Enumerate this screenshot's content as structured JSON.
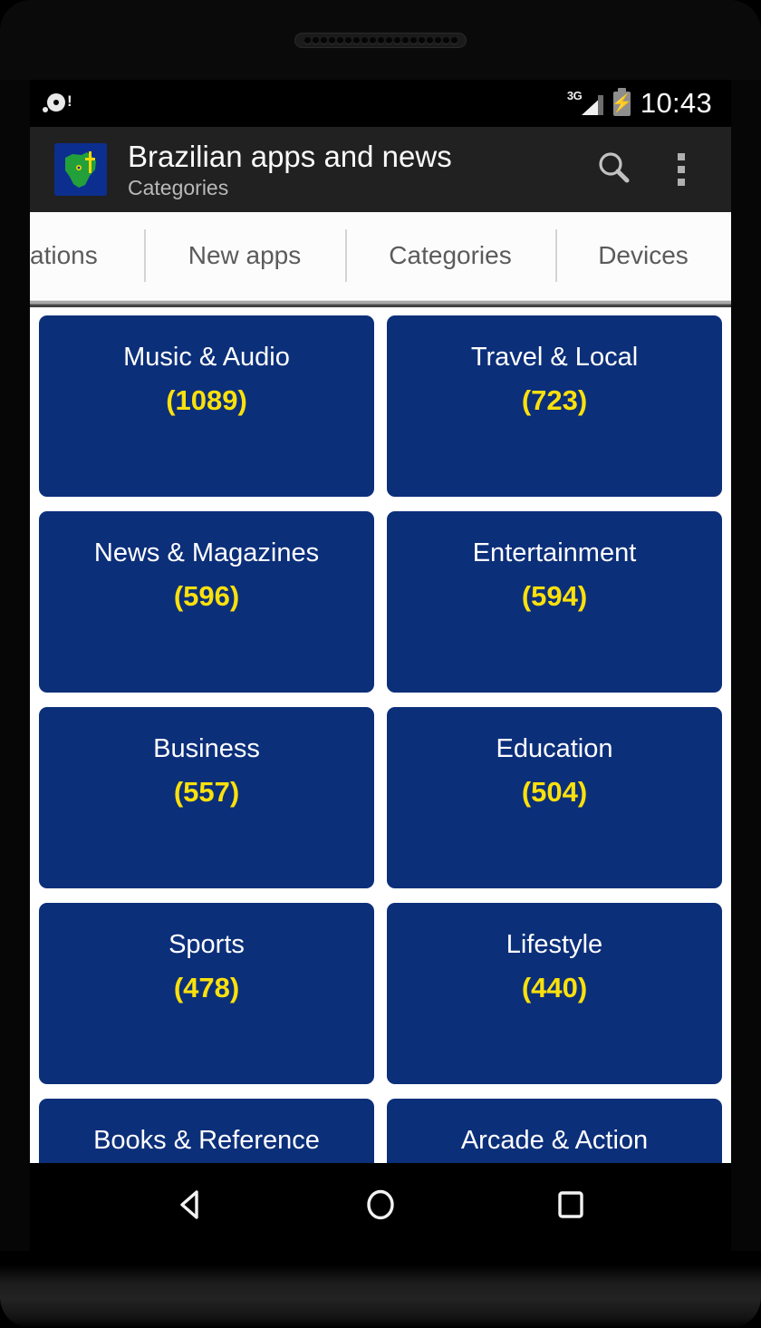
{
  "device": {
    "earpiece_holes": 19,
    "nav": [
      {
        "name": "back",
        "icon": "back-triangle-icon"
      },
      {
        "name": "home",
        "icon": "home-circle-icon"
      },
      {
        "name": "recents",
        "icon": "recents-square-icon"
      }
    ]
  },
  "status_bar": {
    "storage_icon": "sd-card-alert-icon",
    "network_label": "3G",
    "signal_icon": "signal-triangle-icon",
    "battery_icon": "battery-charging-icon",
    "time": "10:43"
  },
  "toolbar": {
    "app_icon": "brazil-map-christ-redeemer-icon",
    "title": "Brazilian apps and news",
    "subtitle": "Categories",
    "search_icon": "search-icon",
    "overflow_icon": "kebab-menu-icon"
  },
  "tabs": [
    {
      "label": "ations",
      "active": false
    },
    {
      "label": "New apps",
      "active": false
    },
    {
      "label": "Categories",
      "active": true
    },
    {
      "label": "Devices",
      "active": false
    }
  ],
  "colors": {
    "card_background": "#0c2f7a",
    "card_title": "#ffffff",
    "card_count": "#fbe10c",
    "toolbar_background": "#212121",
    "tab_text": "#5b5b5b"
  },
  "categories": [
    {
      "name": "Music & Audio",
      "count": "(1089)"
    },
    {
      "name": "Travel & Local",
      "count": "(723)"
    },
    {
      "name": "News & Magazines",
      "count": "(596)"
    },
    {
      "name": "Entertainment",
      "count": "(594)"
    },
    {
      "name": "Business",
      "count": "(557)"
    },
    {
      "name": "Education",
      "count": "(504)"
    },
    {
      "name": "Sports",
      "count": "(478)"
    },
    {
      "name": "Lifestyle",
      "count": "(440)"
    },
    {
      "name": "Books & Reference",
      "count": ""
    },
    {
      "name": "Arcade & Action",
      "count": ""
    }
  ]
}
